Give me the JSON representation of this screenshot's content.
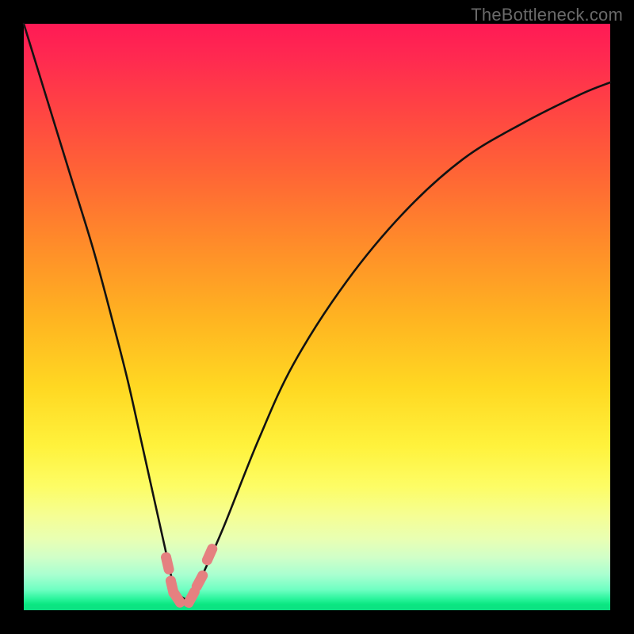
{
  "watermark": "TheBottleneck.com",
  "colors": {
    "frame": "#000000",
    "curve_stroke": "#121212",
    "marker_fill": "#e58080",
    "marker_stroke": "#c95c5c"
  },
  "chart_data": {
    "type": "line",
    "title": "",
    "xlabel": "",
    "ylabel": "",
    "xlim": [
      0,
      100
    ],
    "ylim": [
      0,
      100
    ],
    "grid": false,
    "legend": false,
    "note": "V-shaped bottleneck curve. y roughly represents percent bottleneck (0 at optimum). Values are estimated from curve shape; no axis ticks or numeric labels are rendered in the original image.",
    "x": [
      0,
      4,
      8,
      12,
      16,
      18,
      20,
      22,
      24,
      25.5,
      27,
      28.5,
      30,
      34,
      40,
      46,
      55,
      65,
      75,
      85,
      95,
      100
    ],
    "y": [
      100,
      87,
      74,
      61,
      46,
      38,
      29,
      20,
      11,
      4.5,
      2.2,
      2.2,
      5,
      14,
      29,
      42,
      56,
      68,
      77,
      83,
      88,
      90
    ],
    "markers": [
      {
        "x": 24.5,
        "y": 8.0
      },
      {
        "x": 25.3,
        "y": 4.0
      },
      {
        "x": 26.1,
        "y": 2.2
      },
      {
        "x": 28.6,
        "y": 2.2
      },
      {
        "x": 30.0,
        "y": 5.0
      },
      {
        "x": 31.7,
        "y": 9.5
      }
    ]
  }
}
